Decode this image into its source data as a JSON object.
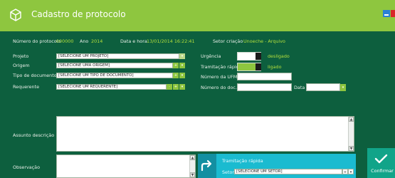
{
  "window": {
    "title": "Cadastro de protocolo",
    "icon": "cube-icon",
    "accent": "#8ec63f",
    "background": "#0d5f3e"
  },
  "info": {
    "protocol_label": "Número do protocolo",
    "protocol_value": "000000",
    "year_label": "Ano",
    "year_value": "2014",
    "datetime_label": "Data e hora",
    "datetime_value": "13/01/2014 16:22:41",
    "sector_label": "Setor criação",
    "sector_value": "Unoeche - Arquivo"
  },
  "form": {
    "projeto": {
      "label": "Projeto",
      "value": "[SELECIONE UM PROJETO]"
    },
    "origem": {
      "label": "Origem",
      "value": "[SELECIONE UMA ORIGEM]"
    },
    "tipo": {
      "label": "Tipo de documento",
      "value": "[SELECIONE UM TIPO DE DOCUMENTO]"
    },
    "requerente": {
      "label": "Requerente",
      "value": "[SELECIONE UM REQUERENTE]"
    },
    "urgencia": {
      "label": "Urgência",
      "state": "desligado"
    },
    "tramitacao": {
      "label": "Tramitação rápida",
      "state": "ligado"
    },
    "ufmt": {
      "label": "Número da UFMT",
      "value": ""
    },
    "doc": {
      "label": "Número do doc.",
      "value": ""
    },
    "data": {
      "label": "Data",
      "value": ""
    },
    "assunto": {
      "label": "Assunto descrição",
      "value": ""
    },
    "observacao": {
      "label": "Observação",
      "value": ""
    }
  },
  "tramitacao_panel": {
    "title": "Tramitação rápida",
    "setor_label": "Setor",
    "setor_value": "[SELECIONE UM SETOR]",
    "color": "#1bbbd0"
  },
  "confirm": {
    "label": "Confirmar",
    "color": "#11a489"
  }
}
